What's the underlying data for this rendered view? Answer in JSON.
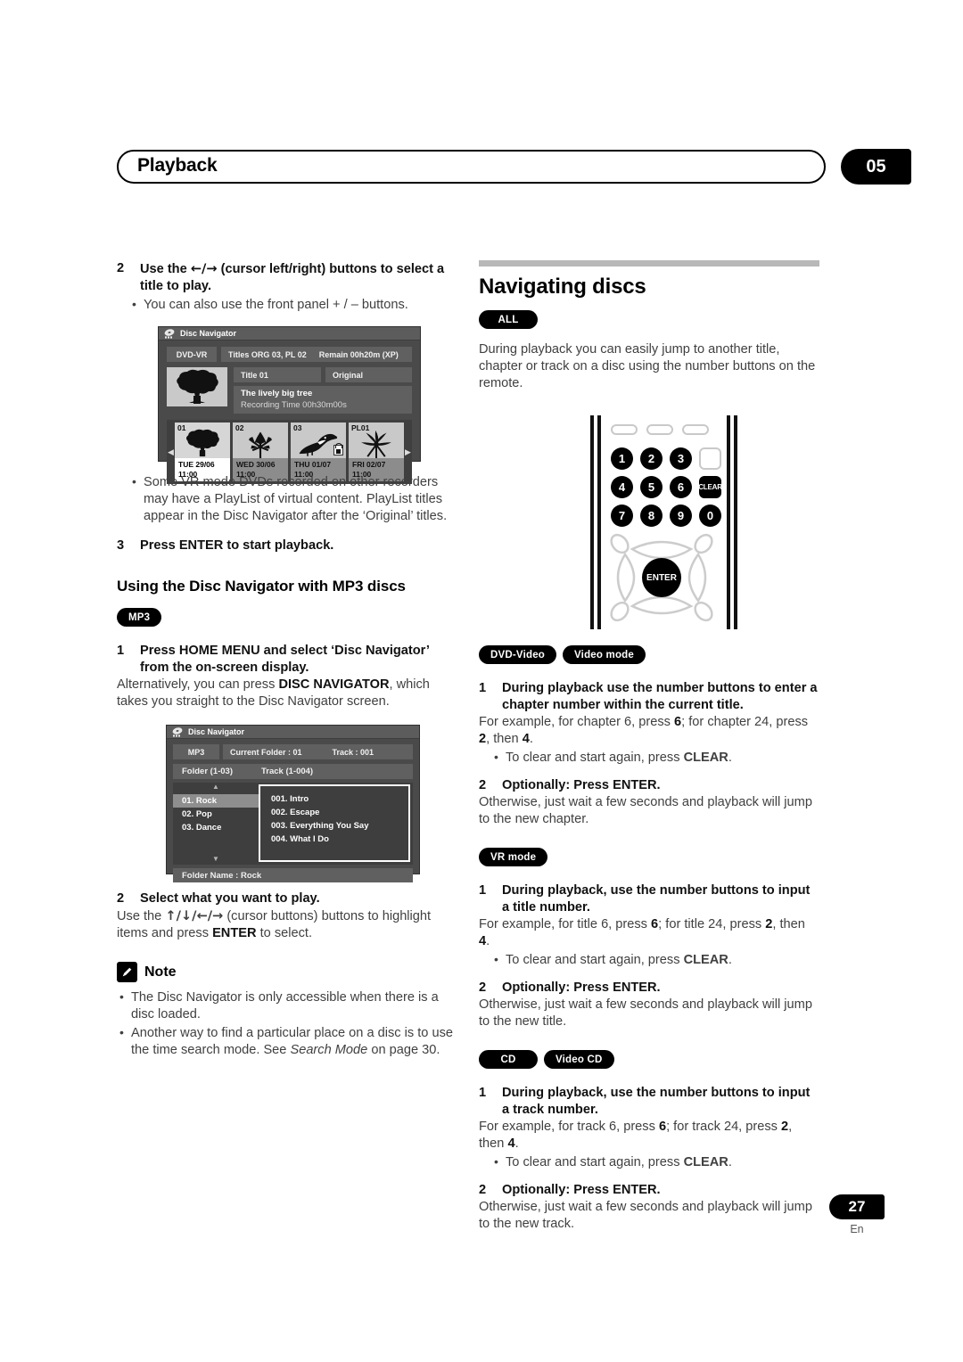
{
  "runhead": {
    "title": "Playback",
    "chapter": "05"
  },
  "footer": {
    "page": "27",
    "lang": "En"
  },
  "left": {
    "step2": {
      "num": "2",
      "text_a": "Use the ",
      "arrows": "←/→",
      "text_b": " (cursor left/right) buttons to select a title to play."
    },
    "step2_bullet": "You can also use the front panel + / – buttons.",
    "vr_bullet": "Some VR mode DVDs recorded on other recorders may have a PlayList of virtual content. PlayList titles appear in the Disc Navigator after the ‘Original’ titles.",
    "step3": {
      "num": "3",
      "text": "Press ENTER to start playback."
    },
    "subhead": "Using the Disc Navigator with MP3 discs",
    "badge_mp3": "MP3",
    "mp3_step1": {
      "num": "1",
      "text": "Press HOME MENU and select ‘Disc Navigator’ from the on-screen display."
    },
    "mp3_step1_body_a": "Alternatively, you can press ",
    "mp3_step1_body_bold": "DISC NAVIGATOR",
    "mp3_step1_body_b": ", which takes you straight to the Disc Navigator screen.",
    "mp3_step2": {
      "num": "2",
      "text": "Select what you want to play."
    },
    "mp3_step2_body_a": "Use the ",
    "mp3_step2_arrows": "↑/↓/←/→",
    "mp3_step2_body_b": " (cursor buttons) buttons to highlight items and press ",
    "mp3_step2_bold": "ENTER",
    "mp3_step2_body_c": " to select.",
    "note_label": "Note",
    "note_items": [
      "The Disc Navigator is only accessible when there is a disc loaded.",
      "Another way to find a particular place on a disc is to use the time search mode. See Search Mode on page 30."
    ],
    "note_item2_a": "Another way to find a particular place on a disc is to use the time search mode. See ",
    "note_item2_ital": "Search Mode",
    "note_item2_b": " on page 30."
  },
  "osd_dvdvr": {
    "window_title": "Disc Navigator",
    "chip_format": "DVD-VR",
    "chip_titles": "Titles ORG 03, PL 02",
    "chip_remain": "Remain  00h20m (XP)",
    "chip_title_no": "Title 01",
    "chip_original": "Original",
    "desc_name": "The lively big tree",
    "desc_time": "Recording Time  00h30m00s",
    "arrow_left": "◀",
    "arrow_right": "▶",
    "cells": [
      {
        "index": "01",
        "date": "TUE 29/06",
        "time": "11:00",
        "art": "tree",
        "selected": true,
        "locked": false
      },
      {
        "index": "02",
        "date": "WED 30/06",
        "time": "11:00",
        "art": "leaf",
        "selected": false,
        "locked": false
      },
      {
        "index": "03",
        "date": "THU 01/07",
        "time": "11:00",
        "art": "bird",
        "selected": false,
        "locked": true
      },
      {
        "index": "PL01",
        "date": "FRI 02/07",
        "time": "11:00",
        "art": "flower",
        "selected": false,
        "locked": false
      }
    ]
  },
  "osd_mp3": {
    "window_title": "Disc Navigator",
    "chip_format": "MP3",
    "chip_current": "Current  Folder  :   01",
    "chip_track": "Track  :   001",
    "bar_folder": "Folder (1-03)",
    "bar_track": "Track (1-004)",
    "folders": [
      {
        "label": "01. Rock",
        "selected": true
      },
      {
        "label": "02. Pop",
        "selected": false
      },
      {
        "label": "03. Dance",
        "selected": false
      }
    ],
    "tracks": [
      "001. Intro",
      "002. Escape",
      "003. Everything You Say",
      "004. What I Do"
    ],
    "scroll_up": "▲",
    "scroll_down": "▼",
    "footer": "Folder Name  :  Rock"
  },
  "right": {
    "section_head": "Navigating discs",
    "badge_all": "ALL",
    "intro": "During playback you can easily jump to another title, chapter or track on a disc using the number buttons on the remote.",
    "remote": {
      "keys_row1": [
        "1",
        "2",
        "3"
      ],
      "key_blank": "",
      "keys_row2": [
        "4",
        "5",
        "6"
      ],
      "key_clear": "CLEAR",
      "keys_row3": [
        "7",
        "8",
        "9",
        "0"
      ],
      "enter": "ENTER"
    },
    "group_dvdvideo": {
      "badges": [
        "DVD-Video",
        "Video mode"
      ],
      "step1": {
        "num": "1",
        "text": "During playback use the number buttons to enter a chapter number within the current title."
      },
      "step1_body_a": "For example, for chapter 6, press ",
      "step1_body_n1": "6",
      "step1_body_b": "; for chapter 24, press ",
      "step1_body_n2": "2",
      "step1_body_c": ", then ",
      "step1_body_n3": "4",
      "step1_body_d": ".",
      "bullet_a": "To clear and start again, press ",
      "bullet_bold": "CLEAR",
      "bullet_b": ".",
      "step2": {
        "num": "2",
        "text": "Optionally: Press ENTER."
      },
      "step2_body": "Otherwise, just wait a few seconds and playback will jump to the new chapter."
    },
    "group_vrmode": {
      "badges": [
        "VR mode"
      ],
      "step1": {
        "num": "1",
        "text": "During playback, use the number buttons to input a title number."
      },
      "step1_body_a": "For example, for title 6, press ",
      "step1_body_n1": "6",
      "step1_body_b": "; for title 24, press ",
      "step1_body_n2": "2",
      "step1_body_c": ", then ",
      "step1_body_n3": "4",
      "step1_body_d": ".",
      "bullet_a": "To clear and start again, press ",
      "bullet_bold": "CLEAR",
      "bullet_b": ".",
      "step2": {
        "num": "2",
        "text": "Optionally: Press ENTER."
      },
      "step2_body": "Otherwise, just wait a few seconds and playback will jump to the new title."
    },
    "group_cd": {
      "badges": [
        "CD",
        "Video CD"
      ],
      "step1": {
        "num": "1",
        "text": "During playback, use the number buttons to input a track number."
      },
      "step1_body_a": "For example, for track 6, press ",
      "step1_body_n1": "6",
      "step1_body_b": "; for track 24, press ",
      "step1_body_n2": "2",
      "step1_body_c": ", then ",
      "step1_body_n3": "4",
      "step1_body_d": ".",
      "bullet_a": "To clear and start again, press ",
      "bullet_bold": "CLEAR",
      "bullet_b": ".",
      "step2": {
        "num": "2",
        "text": "Optionally: Press ENTER."
      },
      "step2_body": "Otherwise, just wait a few seconds and playback will jump to the new track."
    }
  }
}
